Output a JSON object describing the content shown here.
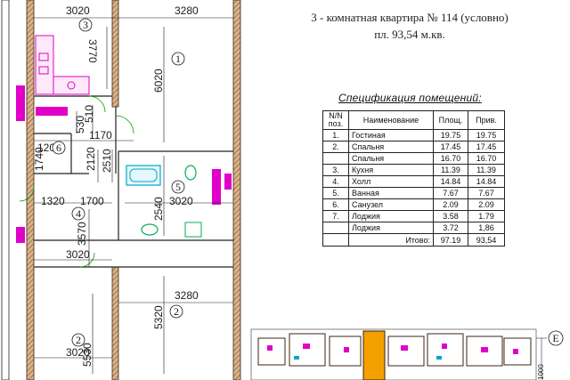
{
  "header": {
    "title_line1": "3 - комнатная квартира № 114  (условно)",
    "title_line2": "пл. 93,54 м.кв."
  },
  "spec": {
    "caption": "Спецификация  помещений:",
    "headers": {
      "num": "N/N поз.",
      "name": "Наименование",
      "area": "Площ.",
      "reduced": "Прив."
    },
    "rows": [
      {
        "num": "1.",
        "name": "Гостиная",
        "area": "19.75",
        "reduced": "19.75"
      },
      {
        "num": "2.",
        "name": "Спальня",
        "area": "17.45",
        "reduced": "17.45"
      },
      {
        "num": "",
        "name": "Спальня",
        "area": "16.70",
        "reduced": "16.70"
      },
      {
        "num": "3.",
        "name": "Кухня",
        "area": "11.39",
        "reduced": "11.39"
      },
      {
        "num": "4.",
        "name": "Холл",
        "area": "14.84",
        "reduced": "14.84"
      },
      {
        "num": "5.",
        "name": "Ванная",
        "area": "7.67",
        "reduced": "7.67"
      },
      {
        "num": "6.",
        "name": "Санузел",
        "area": "2.09",
        "reduced": "2.09"
      },
      {
        "num": "7.",
        "name": "Лоджия",
        "area": "3.58",
        "reduced": "1.79"
      },
      {
        "num": "",
        "name": "Лоджия",
        "area": "3.72",
        "reduced": "1,86"
      }
    ],
    "total": {
      "label": "Итово:",
      "area": "97.19",
      "reduced": "93,54"
    }
  },
  "plan": {
    "dimensions": {
      "d3020_top": "3020",
      "d3280_top": "3280",
      "d3770": "3770",
      "d6020": "6020",
      "d510": "510",
      "d530": "530",
      "d1200": "1200",
      "d1170": "1170",
      "d1740": "1740",
      "d2120": "2120",
      "d2510": "2510",
      "d2540": "2540",
      "d3020_mid": "3020",
      "d1320": "1320",
      "d1700": "1700",
      "d3570": "3570",
      "d3020_low": "3020",
      "d3280_low": "3280",
      "d5320": "5320",
      "d5530": "5530",
      "d3020_bottom": "3020",
      "d1000": "1000"
    },
    "room_markers": {
      "r1": "1",
      "r2a": "2",
      "r2b": "2",
      "r3": "3",
      "r4": "4",
      "r5": "5",
      "r6": "6"
    },
    "axis_marker": "E"
  },
  "colors": {
    "wall": "#8a5a3c",
    "wall_hatch": "#c9a27a",
    "fixture": "#e000c8",
    "dimension": "#1a1a1a",
    "bath": "#00a8c8",
    "sanitary": "#00b050",
    "orange": "#f4a000"
  }
}
